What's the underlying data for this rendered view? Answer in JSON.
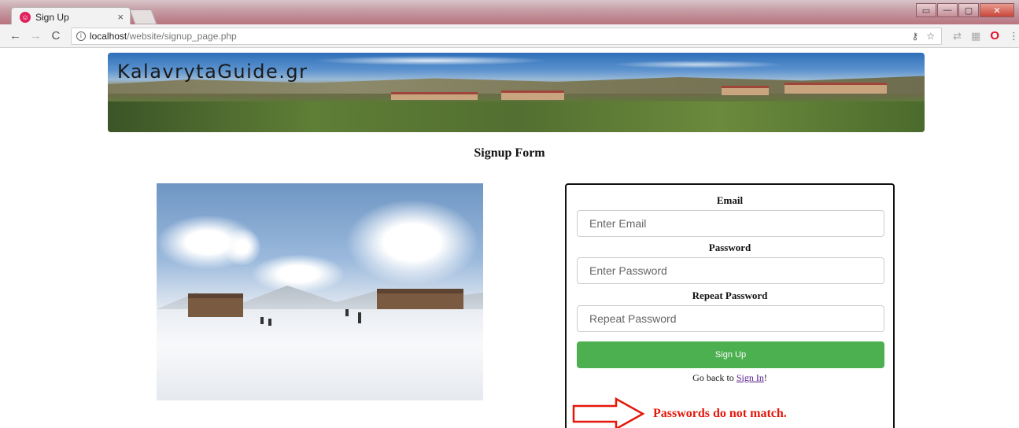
{
  "browser": {
    "tab_title": "Sign Up",
    "tab_close": "×",
    "url_host": "localhost",
    "url_path": "/website/signup_page.php",
    "info_icon_glyph": "i",
    "window_controls": [
      "▭",
      "—",
      "▢",
      "✕"
    ]
  },
  "banner": {
    "title": "KalavrytaGuide.gr"
  },
  "page": {
    "heading": "Signup Form"
  },
  "form": {
    "email_label": "Email",
    "email_placeholder": "Enter Email",
    "password_label": "Password",
    "password_placeholder": "Enter Password",
    "repeat_label": "Repeat Password",
    "repeat_placeholder": "Repeat Password",
    "submit_label": "Sign Up",
    "back_prefix": "Go back to ",
    "back_link": "Sign In",
    "back_suffix": "!",
    "error_message": "Passwords do not match.",
    "error_color": "#e3170a",
    "button_color": "#4caf50"
  }
}
